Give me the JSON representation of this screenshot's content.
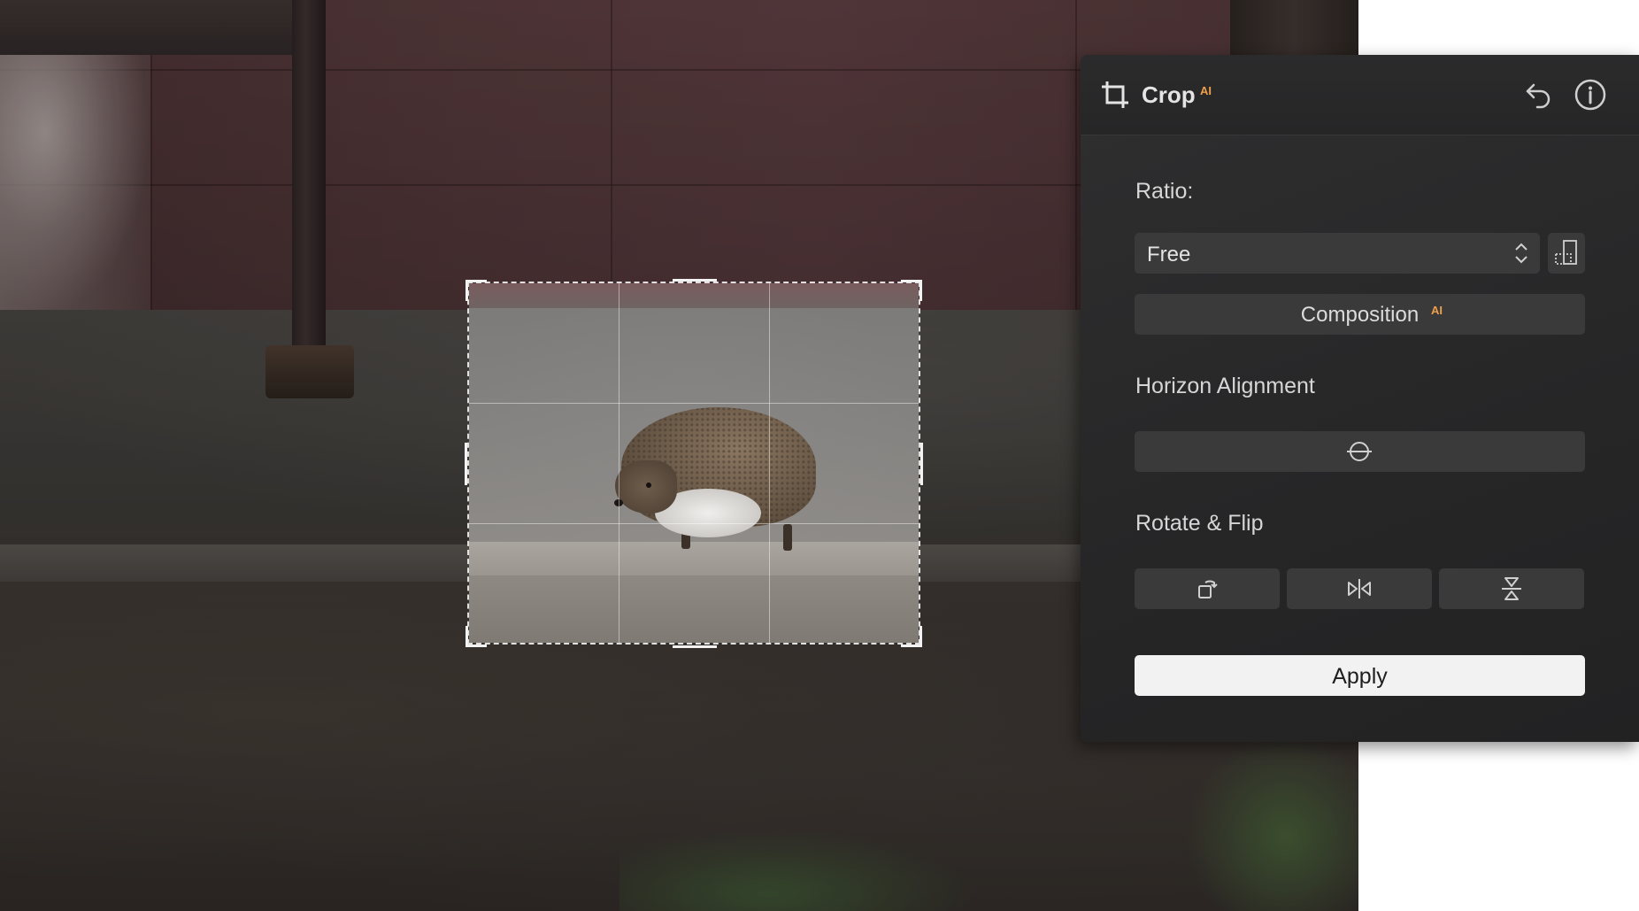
{
  "panel": {
    "title": "Crop",
    "title_badge": "AI",
    "icons": {
      "tool": "crop-icon",
      "undo": "undo-icon",
      "info": "info-icon"
    }
  },
  "ratio": {
    "label": "Ratio:",
    "selected": "Free",
    "swap_icon": "swap-orientation-icon"
  },
  "composition": {
    "label": "Composition",
    "badge": "AI"
  },
  "horizon": {
    "label": "Horizon Alignment",
    "icon": "horizon-level-icon"
  },
  "rotate_flip": {
    "label": "Rotate & Flip",
    "buttons": [
      "rotate-icon",
      "flip-horizontal-icon",
      "flip-vertical-icon"
    ]
  },
  "apply": {
    "label": "Apply"
  },
  "colors": {
    "accent_ai": "#f0a04b",
    "panel_bg": "#262627",
    "button_bg": "#3a3a3b",
    "apply_bg": "#f2f2f2"
  }
}
